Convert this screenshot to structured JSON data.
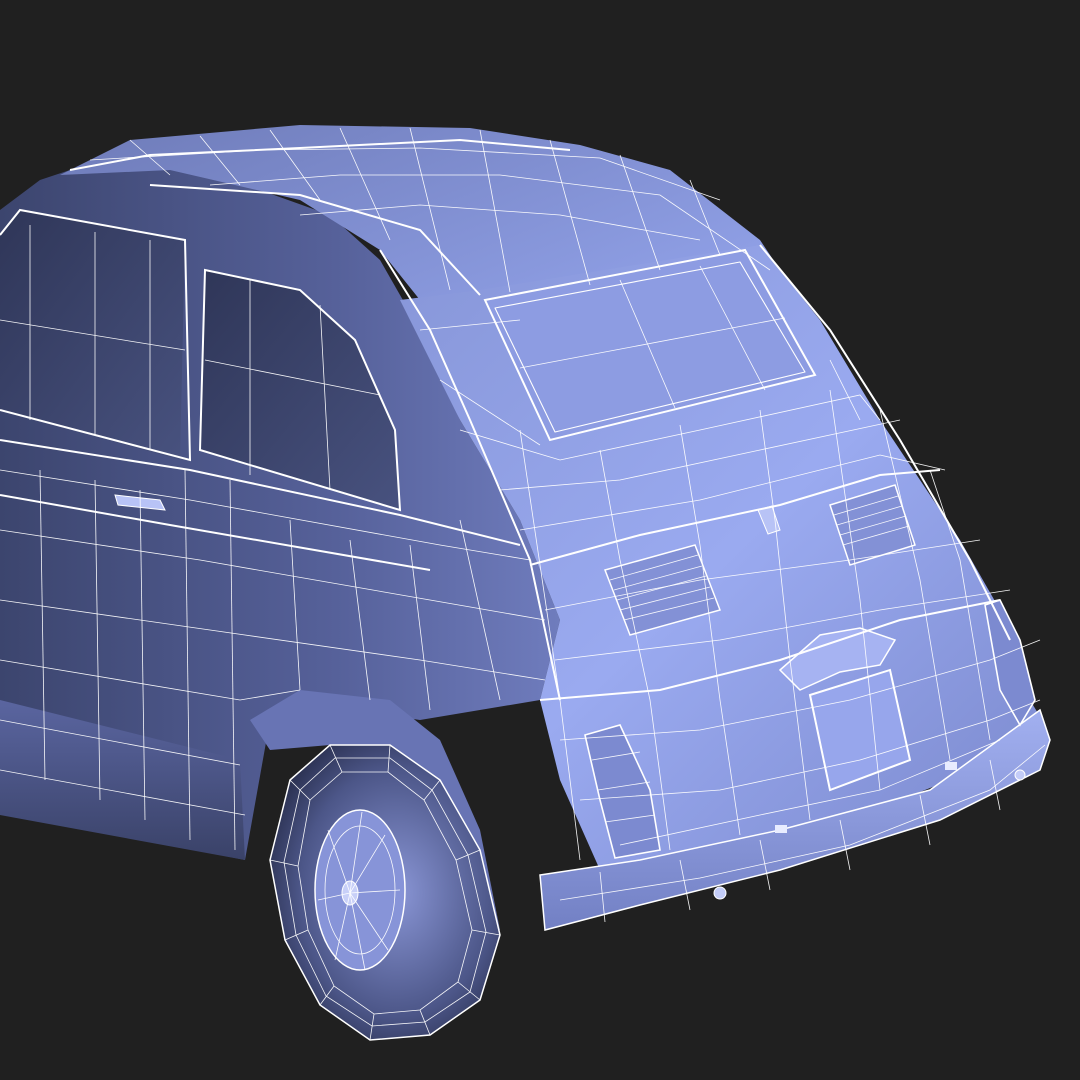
{
  "scene": {
    "subject": "wireframe-car-model",
    "colors": {
      "background": "#202020",
      "body_light": "#94a4e8",
      "body_mid": "#7583c6",
      "body_dark": "#4a5585",
      "body_shadow": "#2e3555",
      "wire": "#ffffff"
    }
  }
}
